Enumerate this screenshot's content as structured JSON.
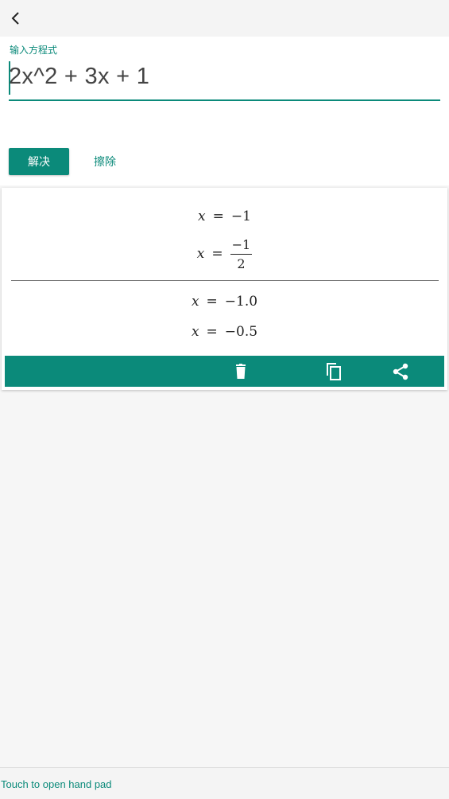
{
  "header": {
    "back_icon": "back-arrow-icon"
  },
  "input": {
    "label": "输入方程式",
    "value": "2x^2 + 3x + 1",
    "solve_label": "解决",
    "clear_label": "擦除"
  },
  "results": {
    "exact": [
      {
        "var": "x",
        "eq": "=",
        "value": "−1"
      },
      {
        "var": "x",
        "eq": "=",
        "numerator": "−1",
        "denominator": "2"
      }
    ],
    "decimal": [
      {
        "var": "x",
        "eq": "=",
        "value": "−1.0"
      },
      {
        "var": "x",
        "eq": "=",
        "value": "−0.5"
      }
    ],
    "actions": [
      "delete-icon",
      "copy-icon",
      "share-icon"
    ]
  },
  "footer": {
    "hand_pad": "Touch to open hand pad"
  },
  "colors": {
    "accent": "#0b8a7a"
  }
}
